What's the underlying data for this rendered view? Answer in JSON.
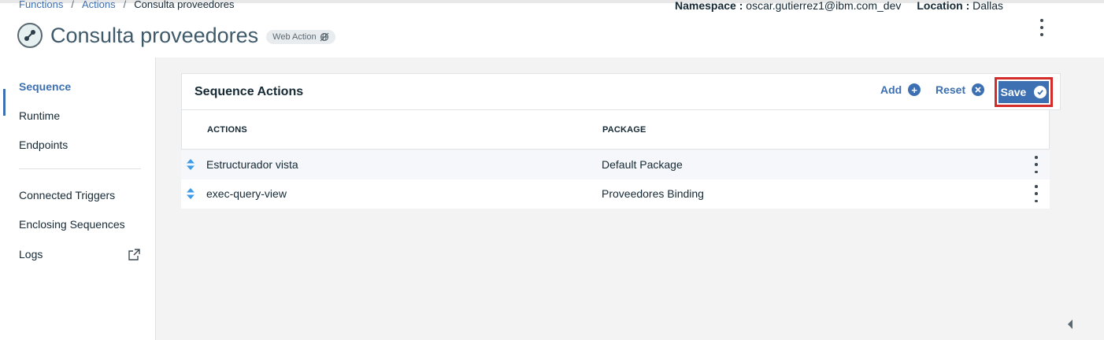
{
  "breadcrumb": {
    "items": [
      "Functions",
      "Actions"
    ],
    "current": "Consulta proveedores"
  },
  "header": {
    "title": "Consulta proveedores",
    "badge": "Web Action",
    "namespace_label": "Namespace :",
    "namespace_value": "oscar.gutierrez1@ibm.com_dev",
    "location_label": "Location :",
    "location_value": "Dallas"
  },
  "sidebar": {
    "items": [
      {
        "label": "Sequence",
        "active": true
      },
      {
        "label": "Runtime"
      },
      {
        "label": "Endpoints"
      },
      {
        "label": "Connected Triggers"
      },
      {
        "label": "Enclosing Sequences"
      },
      {
        "label": "Logs"
      }
    ]
  },
  "card": {
    "title": "Sequence Actions",
    "add_label": "Add",
    "reset_label": "Reset",
    "save_label": "Save"
  },
  "table": {
    "columns": [
      "ACTIONS",
      "PACKAGE"
    ],
    "rows": [
      {
        "action": "Estructurador vista",
        "package": "Default Package"
      },
      {
        "action": "exec-query-view",
        "package": "Proveedores Binding"
      }
    ]
  },
  "colors": {
    "accent": "#3d70b2",
    "save_highlight": "#d42b2b"
  }
}
